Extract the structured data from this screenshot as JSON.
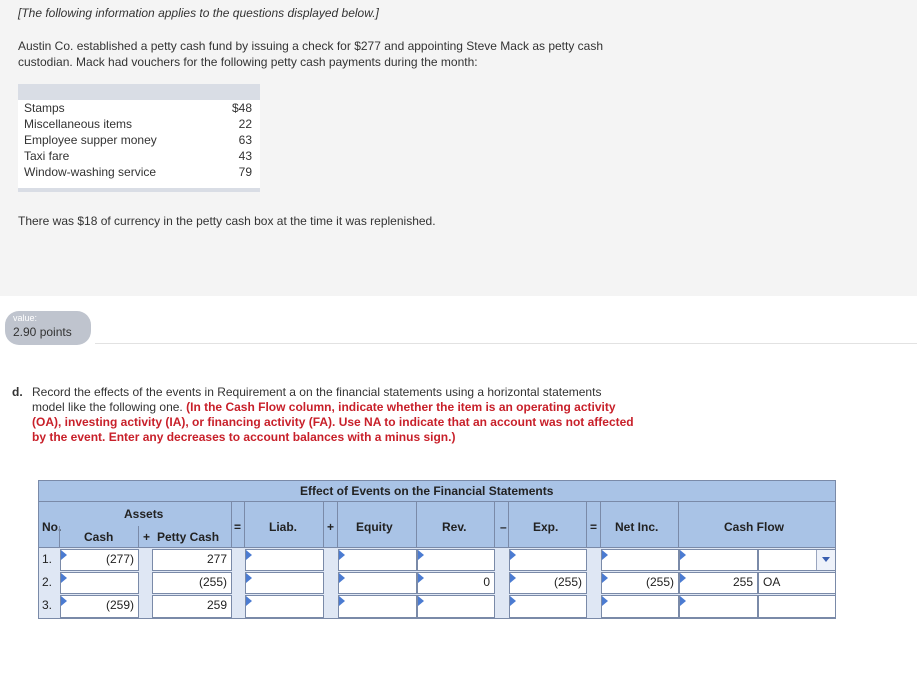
{
  "intro": {
    "note": "[The following information applies to the questions displayed below.]",
    "paragraph1": "Austin Co. established a petty cash fund by issuing a check for $277 and appointing Steve Mack as petty cash custodian. Mack had vouchers for the following petty cash payments during the month:",
    "payments": [
      {
        "label": "Stamps",
        "amount": "$48"
      },
      {
        "label": "Miscellaneous items",
        "amount": "22"
      },
      {
        "label": "Employee supper money",
        "amount": "63"
      },
      {
        "label": "Taxi fare",
        "amount": "43"
      },
      {
        "label": "Window-washing service",
        "amount": "79"
      }
    ],
    "paragraph2": "There was $18 of currency in the petty cash box at the time it was replenished."
  },
  "badge": {
    "label": "value:",
    "points": "2.90 points"
  },
  "question": {
    "letter": "d.",
    "text": "Record the effects of the events in Requirement a on the financial statements using a horizontal statements model like the following one.",
    "instruction": "(In the Cash Flow column, indicate whether the item is an operating activity (OA), investing activity (IA), or financing activity (FA). Use NA to indicate that an account was not affected by the event. Enter any decreases to account balances with a minus sign.)"
  },
  "table": {
    "title": "Effect of Events on the Financial Statements",
    "assets_label": "Assets",
    "headers": {
      "no": "No.",
      "cash": "Cash",
      "plus1": "+",
      "petty_cash": "Petty Cash",
      "eq1": "=",
      "liab": "Liab.",
      "plus2": "+",
      "equity": "Equity",
      "rev": "Rev.",
      "minus": "–",
      "exp": "Exp.",
      "eq2": "=",
      "net_inc": "Net Inc.",
      "cash_flow": "Cash Flow"
    },
    "rows": [
      {
        "no": "1.",
        "cash": "(277)",
        "petty_cash": "277",
        "liab": "",
        "equity": "",
        "rev": "",
        "exp": "",
        "net_inc": "",
        "cf_amount": "",
        "cf_type": ""
      },
      {
        "no": "2.",
        "cash": "",
        "petty_cash": "(255)",
        "liab": "",
        "equity": "",
        "rev": "0",
        "exp": "(255)",
        "net_inc": "(255)",
        "cf_amount": "255",
        "cf_type": "OA"
      },
      {
        "no": "3.",
        "cash": "(259)",
        "petty_cash": "259",
        "liab": "",
        "equity": "",
        "rev": "",
        "exp": "",
        "net_inc": "",
        "cf_amount": "",
        "cf_type": ""
      }
    ]
  }
}
